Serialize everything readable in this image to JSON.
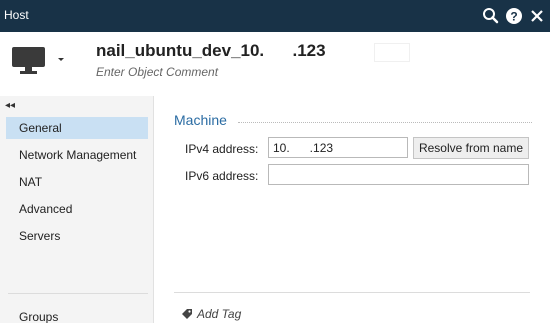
{
  "window": {
    "title": "Host"
  },
  "header": {
    "object_name": "nail_ubuntu_dev_10.      .123",
    "comment_placeholder": "Enter Object Comment",
    "icon": "monitor-icon"
  },
  "sidebar": {
    "items": [
      {
        "label": "General",
        "active": true
      },
      {
        "label": "Network Management",
        "active": false
      },
      {
        "label": "NAT",
        "active": false
      },
      {
        "label": "Advanced",
        "active": false
      },
      {
        "label": "Servers",
        "active": false
      }
    ],
    "groups_label": "Groups"
  },
  "main": {
    "section_title": "Machine",
    "ipv4_label": "IPv4 address:",
    "ipv4_value": "10.      .123",
    "ipv6_label": "IPv6 address:",
    "ipv6_value": "",
    "resolve_button": "Resolve from name",
    "add_tag": "Add Tag"
  },
  "colors": {
    "titlebar": "#183247",
    "accent": "#2b6ca3",
    "active_nav": "#c9e0f3"
  }
}
